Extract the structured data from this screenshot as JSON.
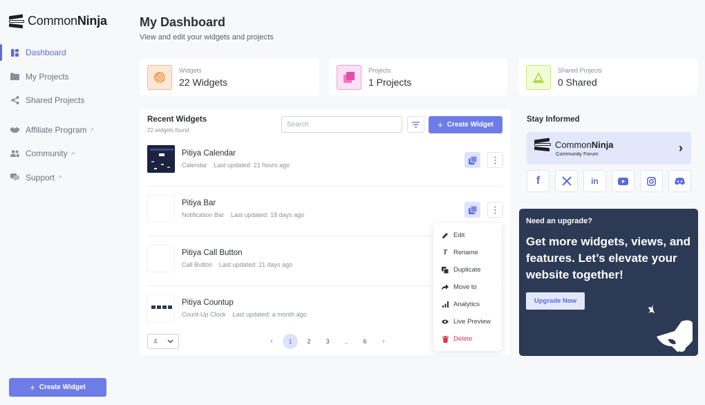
{
  "brand": {
    "name_light": "Common",
    "name_bold": "Ninja"
  },
  "sidebar": {
    "items": [
      {
        "label": "Dashboard",
        "icon": "dashboard-icon",
        "active": true
      },
      {
        "label": "My Projects",
        "icon": "folder-icon"
      },
      {
        "label": "Shared Projects",
        "icon": "share-icon"
      },
      {
        "label": "Affiliate Program",
        "icon": "handshake-icon",
        "external": true
      },
      {
        "label": "Community",
        "icon": "users-icon",
        "external": true
      },
      {
        "label": "Support",
        "icon": "chat-icon",
        "external": true
      }
    ],
    "create_label": "Create Widget"
  },
  "header": {
    "title": "My Dashboard",
    "subtitle": "View and edit your widgets and projects"
  },
  "stats": [
    {
      "label": "Widgets",
      "value": "22 Widgets"
    },
    {
      "label": "Projects",
      "value": "1 Projects"
    },
    {
      "label": "Shared Projects",
      "value": "0 Shared"
    }
  ],
  "recent": {
    "title": "Recent Widgets",
    "count": "22 widgets found",
    "search_placeholder": "Search",
    "create_label": "Create Widget",
    "widgets": [
      {
        "name": "Pitiya Calendar",
        "type": "Calendar",
        "updated": "Last updated: 21 hours ago"
      },
      {
        "name": "Pitiya Bar",
        "type": "Notification Bar",
        "updated": "Last updated: 18 days ago"
      },
      {
        "name": "Pitiya Call Button",
        "type": "Call Button",
        "updated": "Last updated: 21 days ago"
      },
      {
        "name": "Pitiya Countup",
        "type": "Count-Up Clock",
        "updated": "Last updated: a month ago"
      }
    ],
    "per_page": "4",
    "pages": [
      "1",
      "2",
      "3",
      "..",
      "6"
    ],
    "current_page": "1"
  },
  "menu": {
    "items": [
      {
        "label": "Edit",
        "icon": "pencil-icon"
      },
      {
        "label": "Rename",
        "icon": "text-icon"
      },
      {
        "label": "Duplicate",
        "icon": "duplicate-icon"
      },
      {
        "label": "Move to",
        "icon": "move-icon"
      },
      {
        "label": "Analytics",
        "icon": "analytics-icon"
      },
      {
        "label": "Live Preview",
        "icon": "eye-icon"
      },
      {
        "label": "Delete",
        "icon": "trash-icon",
        "danger": true
      }
    ]
  },
  "stay": {
    "title": "Stay Informed",
    "forum_light": "Common",
    "forum_bold": "Ninja",
    "forum_sub": "Community Forum",
    "socials": [
      "facebook-icon",
      "x-icon",
      "linkedin-icon",
      "youtube-icon",
      "instagram-icon",
      "discord-icon"
    ]
  },
  "upgrade": {
    "kicker": "Need an upgrade?",
    "headline": "Get more widgets, views, and features. Let’s elevate your website together!",
    "button": "Upgrade Now"
  },
  "colors": {
    "accent": "#6d7ce6",
    "upgrade_bg": "#2c3a55",
    "danger": "#e0344f"
  }
}
